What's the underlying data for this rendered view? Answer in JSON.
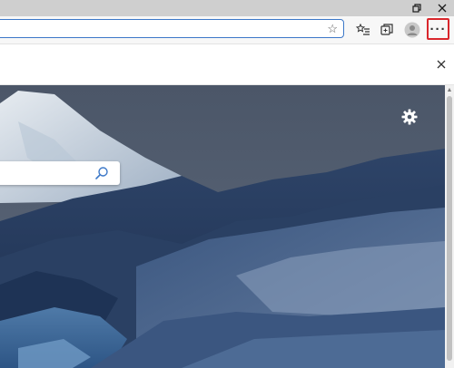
{
  "window_controls": {
    "restore_icon": "restore-icon",
    "close_icon": "close-icon"
  },
  "toolbar": {
    "address_value": "",
    "favorite_icon": "star-icon",
    "favorites_icon": "favorites-list-icon",
    "collections_icon": "collections-icon",
    "profile_icon": "profile-avatar-icon",
    "more_label": "···",
    "more_highlight_color": "#d9262c"
  },
  "info_strip": {
    "close_icon": "close-icon"
  },
  "new_tab_page": {
    "background": "mountain-landscape",
    "settings_icon": "gear-icon",
    "search_placeholder": "",
    "search_icon": "search-icon"
  },
  "colors": {
    "titlebar": "#cfcfcf",
    "toolbar": "#f7f7f7",
    "address_focus": "#3c78c8",
    "accent": "#3c78c8"
  }
}
